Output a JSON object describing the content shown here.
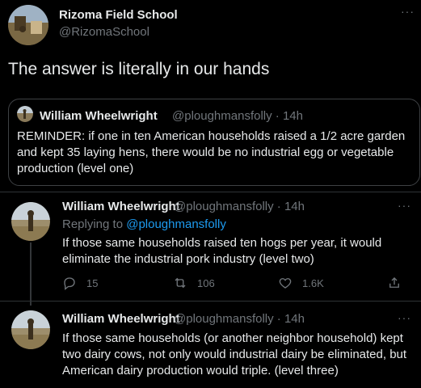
{
  "main_tweet": {
    "author_name": "Rizoma Field School",
    "author_handle": "@RizomaSchool",
    "text": "The answer is literally in our hands",
    "more_icon": "···"
  },
  "quote": {
    "author_name": "William Wheelwright",
    "author_handle": "@ploughmansfolly · 14h",
    "text": "REMINDER: if one in ten American households raised a 1/2 acre garden and kept 35 laying hens, there would be no industrial egg or vegetable production (level one)"
  },
  "replies": [
    {
      "author_name": "William Wheelwright",
      "author_handle": "@ploughmansfolly · 14h",
      "replying_prefix": "Replying to ",
      "replying_to": "@ploughmansfolly",
      "text": "If those same households raised ten hogs per year, it would eliminate the industrial pork industry (level two)",
      "reply_count": "15",
      "retweet_count": "106",
      "like_count": "1.6K",
      "more_icon": "···"
    },
    {
      "author_name": "William Wheelwright",
      "author_handle": "@ploughmansfolly · 14h",
      "text": "If those same households (or another neighbor household) kept two dairy cows, not only would industrial dairy be eliminated, but American dairy production would triple. (level three)",
      "more_icon": "···"
    }
  ],
  "colors": {
    "background": "#000000",
    "text": "#e7e9ea",
    "secondary": "#71767b",
    "link": "#1d9bf0",
    "border": "#2f3336"
  },
  "icons": {
    "reply": "reply-icon",
    "retweet": "retweet-icon",
    "like": "heart-icon",
    "share": "share-icon"
  }
}
